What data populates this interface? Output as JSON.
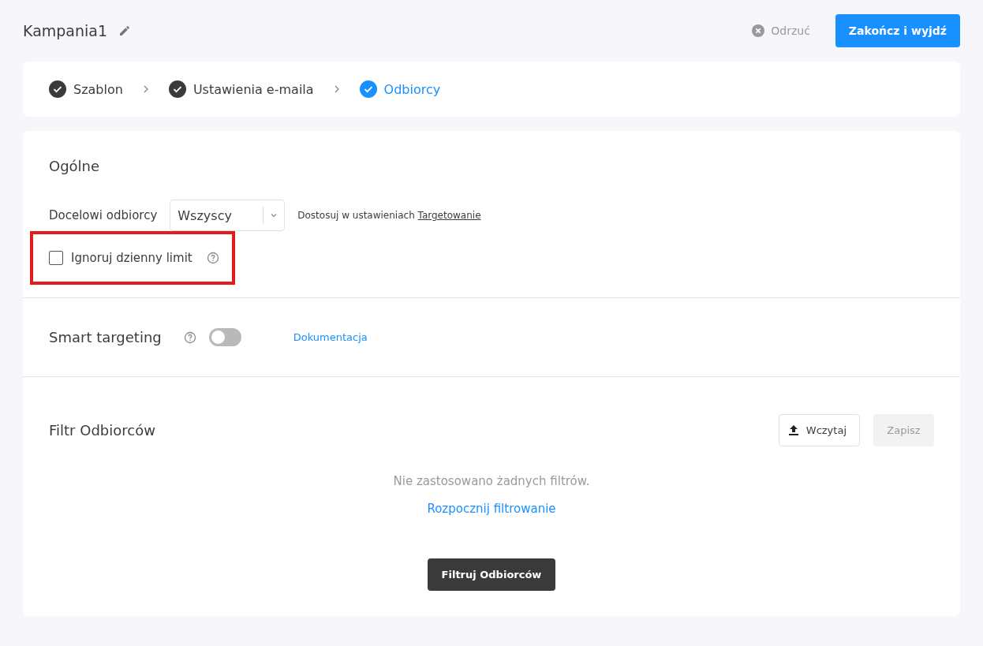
{
  "header": {
    "title": "Kampania1",
    "discard": "Odrzuć",
    "finish": "Zakończ i wyjdź"
  },
  "steps": [
    {
      "label": "Szablon",
      "selected": false
    },
    {
      "label": "Ustawienia e-maila",
      "selected": false
    },
    {
      "label": "Odbiorcy",
      "selected": true
    }
  ],
  "general": {
    "title": "Ogólne",
    "audience_label": "Docelowi odbiorcy",
    "audience_value": "Wszyscy",
    "hint": "Dostosuj w ustawieniach",
    "hint_link": "Targetowanie",
    "ignore_limit": {
      "label": "Ignoruj dzienny limit",
      "checked": false,
      "highlighted": true
    }
  },
  "smart_targeting": {
    "title": "Smart targeting",
    "on": false,
    "link": "Dokumentacja"
  },
  "filter": {
    "title": "Filtr Odbiorców",
    "load": "Wczytaj",
    "save": "Zapisz",
    "save_disabled": true,
    "empty": "Nie zastosowano żadnych filtrów.",
    "start": "Rozpocznij filtrowanie",
    "apply": "Filtruj Odbiorców"
  }
}
